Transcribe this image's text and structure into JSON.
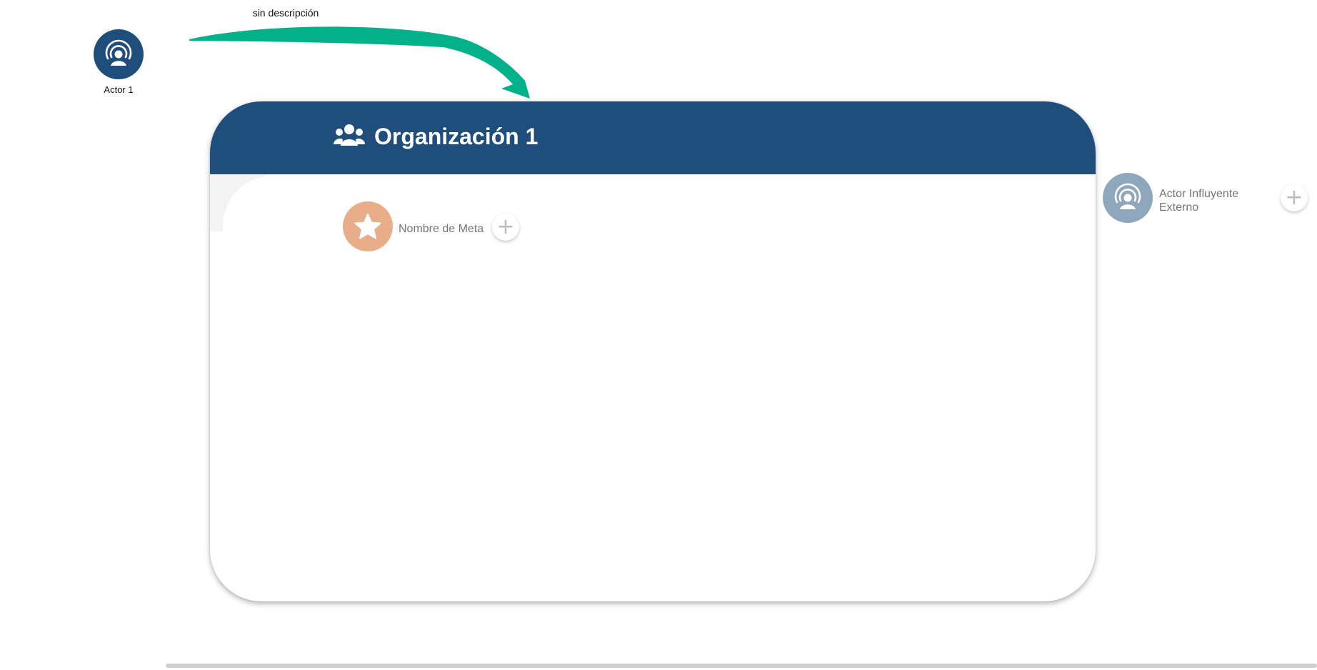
{
  "edge": {
    "label": "sin descripción",
    "color": "#00b189"
  },
  "actor": {
    "label": "Actor 1",
    "icon": "actor-broadcast-icon",
    "color": "#1f4e7c"
  },
  "organization": {
    "title": "Organización 1",
    "icon": "group-users-icon",
    "header_color": "#1f4e7c"
  },
  "goal": {
    "label": "Nombre de Meta",
    "icon": "star-icon",
    "color": "#e8ae8a",
    "add_symbol": "+"
  },
  "external_actor": {
    "label": "Actor Influyente Externo",
    "icon": "actor-broadcast-icon",
    "color": "#8fa7bd",
    "add_symbol": "+"
  }
}
